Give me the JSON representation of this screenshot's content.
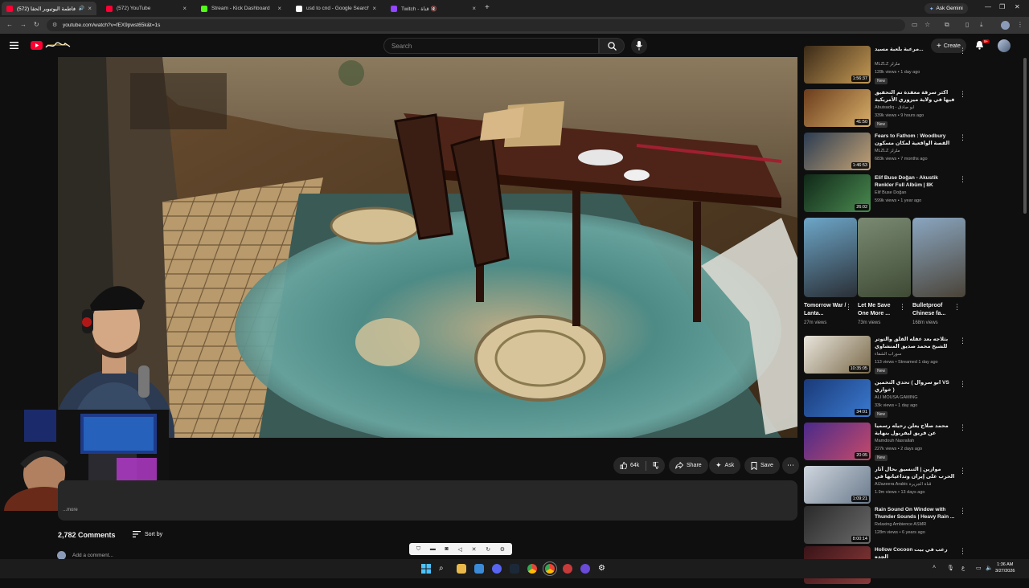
{
  "browser": {
    "tabs": [
      {
        "title": "(572) فاطمة اليوتيوبر الحقا",
        "favicon_color": "#ff0033",
        "active": true,
        "audio": "🔊"
      },
      {
        "title": "(572) YouTube",
        "favicon_color": "#ff0033",
        "active": false
      },
      {
        "title": "Stream - Kick Dashboard",
        "favicon_color": "#53fc18",
        "active": false
      },
      {
        "title": "usd to cnd - Google Search",
        "favicon_color": "#ffffff",
        "active": false
      },
      {
        "title": "Twitch - قناة 🔇",
        "favicon_color": "#9146ff",
        "active": false
      }
    ],
    "new_tab": "+",
    "ask_gemini": "Ask Gemini",
    "url": "youtube.com/watch?v=fEX9pwst65k&t=1s"
  },
  "youtube": {
    "search_placeholder": "Search",
    "create_label": "Create",
    "notification_count": "9+"
  },
  "video": {
    "likes": "64k",
    "share_label": "Share",
    "ask_label": "Ask",
    "save_label": "Save",
    "more_text": "...more",
    "comments_count": "2,782 Comments",
    "sort_label": "Sort by",
    "add_comment_placeholder": "Add a comment..."
  },
  "sidebar": {
    "videos_top": [
      {
        "title": "مرعبة بلعبة مسيد...",
        "channel": "MLZLZ ملزلز",
        "meta": "128k views • 1 day ago",
        "duration": "1:56:37",
        "badge": "New",
        "colors": [
          "#3b2a18",
          "#c59a55"
        ]
      },
      {
        "title": "اكثر سرقة معقدة تم التحقيق فيها في ولاية ميزوري الأمريكية",
        "channel": "Abuisadiq - أبو صادق",
        "meta": "339k views • 9 hours ago",
        "duration": "41:50",
        "badge": "New",
        "colors": [
          "#6a3c1c",
          "#d9b06a"
        ]
      },
      {
        "title": "Fears to Fathom : Woodbury القصة الواقعية لمكان مسكون",
        "channel": "MLZLZ ملزلز",
        "meta": "683k views • 7 months ago",
        "duration": "1:46:53",
        "badge": "",
        "colors": [
          "#2b3c52",
          "#c4a274"
        ]
      },
      {
        "title": "Elif Buse Doğan - Akustik Renkler Full Albüm | 8K",
        "channel": "Elif Buse Doğan",
        "meta": "599k views • 1 year ago",
        "duration": "26:02",
        "badge": "",
        "colors": [
          "#102818",
          "#4a8a50"
        ]
      }
    ],
    "shorts": [
      {
        "title": "Tomorrow War / Lanta...",
        "views": "27m views",
        "colors": [
          "#6da6c8",
          "#2a2f36"
        ]
      },
      {
        "title": "Let Me Save One More ...",
        "views": "73m views",
        "colors": [
          "#7a8a72",
          "#3f4a35"
        ]
      },
      {
        "title": "Bulletproof Chinese fa...",
        "views": "168m views",
        "colors": [
          "#8aa6c0",
          "#4a4338"
        ]
      }
    ],
    "videos_bottom": [
      {
        "title": "بثلاجه بعد عقله القلق والتوتر للشيخ محمد صديق المنشاوي",
        "channel": "سوراب الشفاء",
        "meta": "113 views • Streamed 1 day ago",
        "duration": "10:35:05",
        "badge": "New",
        "colors": [
          "#e9e5dc",
          "#7a6a4a"
        ]
      },
      {
        "title": "تحدي التخمين ( ابو سروال VS خواري )",
        "channel": "ALI MOUSA GAMING",
        "meta": "33k views • 1 day ago",
        "duration": "34:01",
        "badge": "New",
        "colors": [
          "#1a3a78",
          "#3a7ad0"
        ]
      },
      {
        "title": "محمد صلاح يعلن رحيله رسميا عن فريق ليفربول بنهاية الموسم الحالي",
        "channel": "Mamdouh Nasrallah",
        "meta": "227k views • 2 days ago",
        "duration": "20:05",
        "badge": "New",
        "colors": [
          "#4a2a8a",
          "#c64a6a"
        ]
      },
      {
        "title": "موازين | التنسيق بحال آثار الحرب على إيران وتداعياتها في المنطقة",
        "channel": "AlJazeera Arabic قناة الجزيرة",
        "meta": "1.9m views • 13 days ago",
        "duration": "1:09:21",
        "badge": "",
        "colors": [
          "#cfd6de",
          "#6a7a8c"
        ]
      },
      {
        "title": "Rain Sound On Window with Thunder Sounds | Heavy Rain ...",
        "channel": "Relaxing Ambience ASMR",
        "meta": "128m views • 6 years ago",
        "duration": "8:00:14",
        "badge": "",
        "colors": [
          "#2a2a2a",
          "#6a6a6a"
        ]
      },
      {
        "title": "Hollow Cocoon رعب في بيت الجده",
        "channel": "",
        "meta": "",
        "duration": "",
        "badge": "",
        "colors": [
          "#3a1418",
          "#8a3a3a"
        ]
      }
    ]
  },
  "taskbar": {
    "time": "1:36 AM",
    "date": "3/27/2026"
  }
}
